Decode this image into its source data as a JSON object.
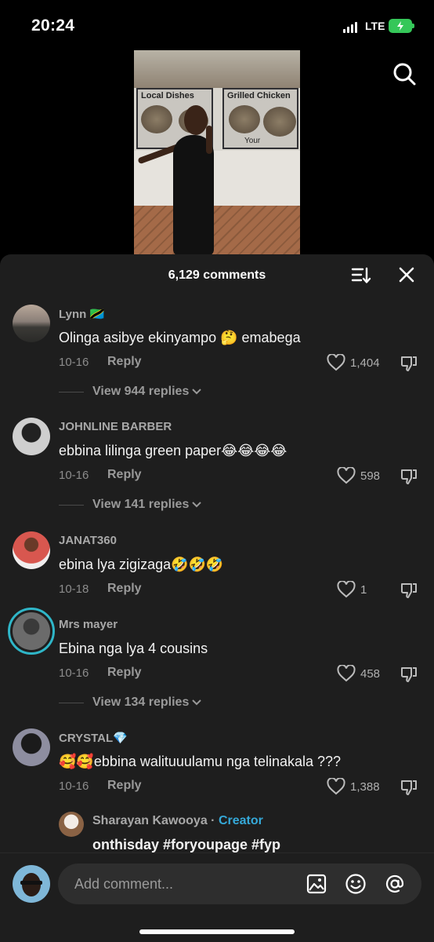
{
  "status": {
    "time": "20:24",
    "network": "LTE"
  },
  "video": {
    "sign_left": "Local Dishes",
    "sign_right": "Grilled Chicken",
    "sign_sub": "Your"
  },
  "sheet": {
    "comments_count": "6,129 comments"
  },
  "comments": [
    {
      "user": "Lynn 🇹🇿",
      "text": "Olinga asibye ekinyampo 🤔 emabega",
      "date": "10-16",
      "reply": "Reply",
      "likes": "1,404",
      "view_replies": "View 944 replies"
    },
    {
      "user": "JOHNLINE BARBER",
      "text": "ebbina lilinga green paper😂😂😂😂",
      "date": "10-16",
      "reply": "Reply",
      "likes": "598",
      "view_replies": "View 141 replies"
    },
    {
      "user": "JANAT360",
      "text": "ebina lya zigizaga🤣🤣🤣",
      "date": "10-18",
      "reply": "Reply",
      "likes": "1"
    },
    {
      "user": "Mrs mayer",
      "text": "Ebina nga lya 4 cousins",
      "date": "10-16",
      "reply": "Reply",
      "likes": "458",
      "view_replies": "View 134 replies"
    },
    {
      "user": "CRYSTAL💎",
      "text": "🥰🥰ebbina walituuulamu nga telinakala ???",
      "date": "10-16",
      "reply": "Reply",
      "likes": "1,388"
    }
  ],
  "creator_reply": {
    "user": "Sharayan Kawooya",
    "separator": " · ",
    "tag": "Creator",
    "text": "onthisday #foryoupage #fyp"
  },
  "input": {
    "placeholder": "Add comment..."
  },
  "colors": {
    "accent": "#35a9d9",
    "battery": "#35c759",
    "sheet_bg": "#1e1e1e"
  }
}
